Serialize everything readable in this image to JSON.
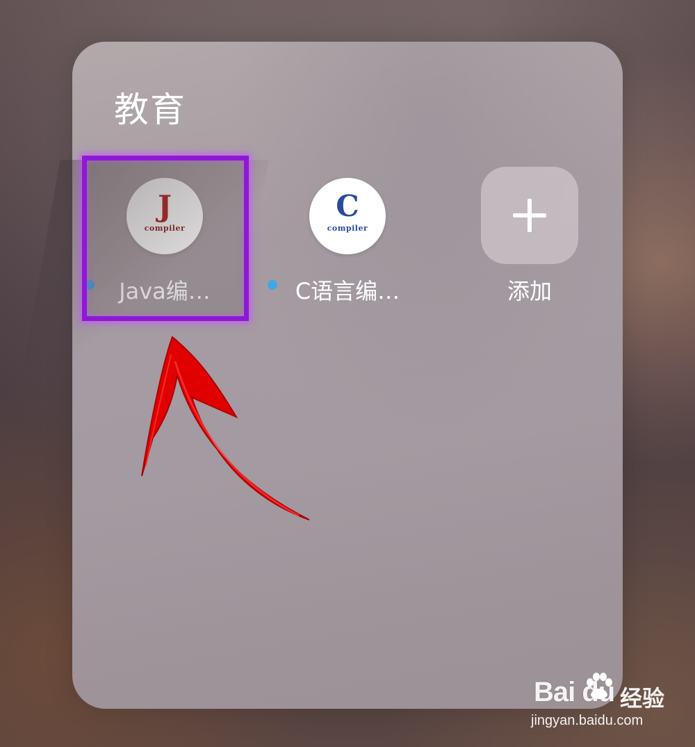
{
  "folder": {
    "title": "教育",
    "apps": [
      {
        "label": "Java编…",
        "icon_name": "java-compiler-icon",
        "icon_letter": "J",
        "icon_subtext": "compiler",
        "icon_color": "#b31b1b",
        "has_new_dot": true
      },
      {
        "label": "C语言编…",
        "icon_name": "c-compiler-icon",
        "icon_letter": "C",
        "icon_subtext": "compiler",
        "icon_color": "#2a4aa0",
        "has_new_dot": true
      }
    ],
    "add_button": {
      "label": "添加",
      "icon_name": "plus-icon"
    },
    "new_dot_color": "#3fa7e6"
  },
  "annotation": {
    "highlight_color": "#8e18d8",
    "arrow_color": "#e00000"
  },
  "watermark": {
    "logo": "Bai du",
    "cn_text": "经验",
    "url": "jingyan.baidu.com"
  }
}
